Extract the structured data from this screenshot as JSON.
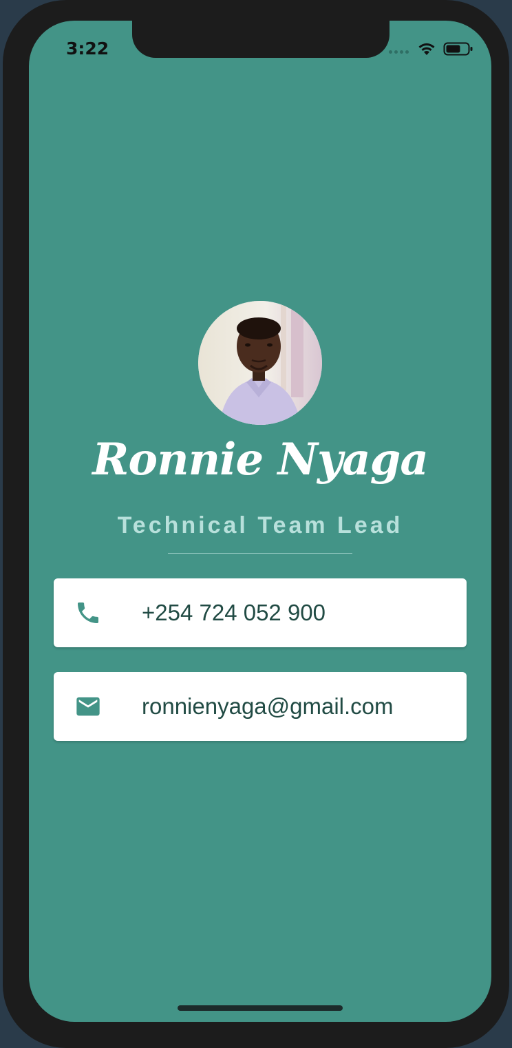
{
  "status_bar": {
    "time": "3:22"
  },
  "profile": {
    "name": "Ronnie Nyaga",
    "role": "Technical Team Lead"
  },
  "contacts": {
    "phone": {
      "icon": "phone-icon",
      "value": "+254 724 052 900"
    },
    "email": {
      "icon": "mail-icon",
      "value": "ronnienyaga@gmail.com"
    }
  },
  "colors": {
    "background": "#439487",
    "card": "#ffffff",
    "card_text": "#214b44",
    "role_text": "#b8e0db",
    "icon": "#439487"
  }
}
